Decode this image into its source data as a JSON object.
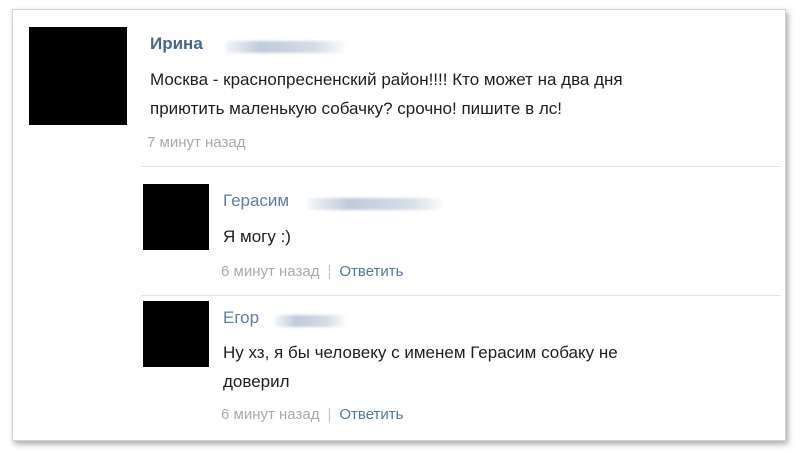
{
  "post": {
    "author": "Ирина",
    "text_line1": "Москва - краснопресненский район!!!! Кто может на два дня",
    "text_line2": "приютить маленькую собачку? срочно! пишите в лс!",
    "time": "7 минут назад"
  },
  "comments": [
    {
      "author": "Герасим",
      "text_line1": "Я могу :)",
      "time": "6 минут назад",
      "reply_label": "Ответить"
    },
    {
      "author": "Егор",
      "text_line1": "Ну хз, я бы человеку с именем Герасим собаку не",
      "text_line2": "доверил",
      "time": "6 минут назад",
      "reply_label": "Ответить"
    }
  ],
  "colors": {
    "author_name": "#45688e",
    "reply_link": "#4f78a3",
    "timestamp": "#a9a9a9",
    "avatar": "#000000"
  }
}
